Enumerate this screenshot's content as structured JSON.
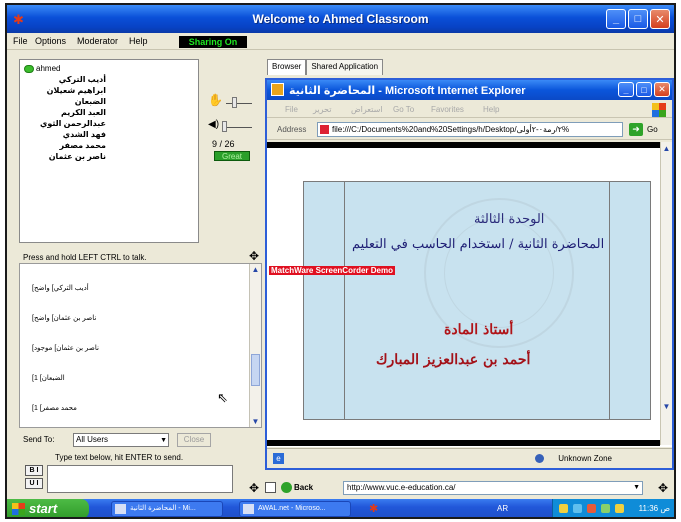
{
  "window": {
    "title": "Welcome to  Ahmed Classroom"
  },
  "menu": {
    "file": "File",
    "options": "Options",
    "moderator": "Moderator",
    "help": "Help",
    "sharing_status": "Sharing On"
  },
  "users": [
    "ahmed",
    "أديب التركي",
    "ابراهيم شعيلان",
    "الضبعان",
    "العبد الكريم",
    "عبدالرحمن الثوي",
    "فهد الشدي",
    "محمد مصفر",
    "ناصر بن عثمان"
  ],
  "controls": {
    "counter": "9 / 26",
    "status": "Great"
  },
  "press_hint": "Press and hold LEFT CTRL to talk.",
  "chat": {
    "messages": [
      "أديب التركي] واضح]",
      "ناصر بن عثمان] واضح]",
      "ناصر بن عثمان] موجود]",
      "الضبعان] 1]",
      "محمد مصفر] 1]"
    ]
  },
  "send": {
    "label": "Send To:",
    "target": "All Users",
    "close": "Close",
    "hint": "Type text below, hit ENTER to send.",
    "bold": "B",
    "italic": "I",
    "underline": "U",
    "italic2": "I"
  },
  "tabs": {
    "browser": "Browser",
    "shared": "Shared Application"
  },
  "ie": {
    "title": "المحاضرة الثانية - Microsoft Internet Explorer",
    "menu": {
      "file": "File",
      "edit": "تحرير",
      "view": "استعراض",
      "goto": "Go To",
      "favorites": "Favorites",
      "help": "Help"
    },
    "address_label": "Address",
    "address": "file:///C:/Documents%20and%20Settings/h/Desktop/٢/رمة٠-٢أولى%",
    "go": "Go",
    "status_zone": "Unknown Zone"
  },
  "slide": {
    "unit": "الوحدة الثالثة",
    "lecture": "المحاضرة الثانية / استخدام الحاسب في التعليم",
    "demo_banner": "MatchWare ScreenCorder Demo",
    "professor_label": "أستاذ المادة",
    "professor_name": "أحمد بن عبدالعزيز المبارك"
  },
  "nav": {
    "back": "Back",
    "url": "http://www.vuc.e-education.ca/"
  },
  "taskbar": {
    "start": "start",
    "tasks": [
      "المحاضرة الثانية - Mi...",
      "AWAL.net - Microso..."
    ],
    "lang": "AR",
    "clock": "11:36 ص"
  },
  "colors": {
    "titlebar": "#0a4fd8",
    "sharing_text": "#1ee820",
    "slide_bg": "#c8e2ef",
    "slide_heading": "#1d1d74",
    "slide_name": "#a31219",
    "demo_banner": "#e01020"
  }
}
